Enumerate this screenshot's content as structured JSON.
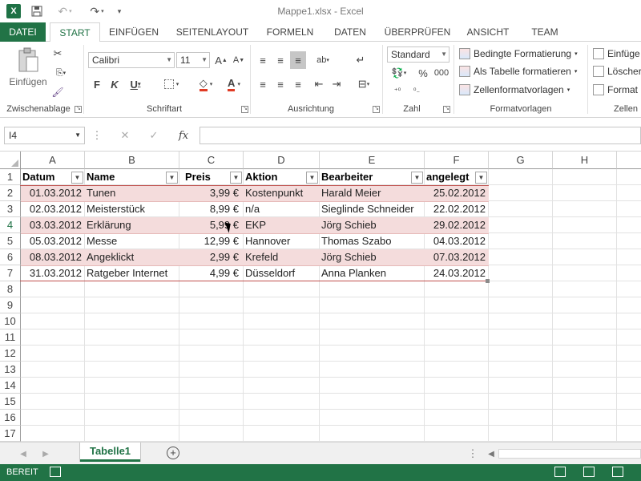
{
  "window": {
    "title": "Mappe1.xlsx - Excel",
    "app_logo": "X"
  },
  "quick_access": {
    "save_icon": "save-icon",
    "undo_icon": "undo-icon",
    "redo_icon": "redo-icon",
    "customize_icon": "customize-icon"
  },
  "tabs": {
    "file": "DATEI",
    "items": [
      "START",
      "EINFÜGEN",
      "SEITENLAYOUT",
      "FORMELN",
      "DATEN",
      "ÜBERPRÜFEN",
      "ANSICHT",
      "TEAM"
    ],
    "active": "START"
  },
  "ribbon": {
    "clipboard": {
      "paste_label": "Einfügen",
      "group_label": "Zwischenablage"
    },
    "font": {
      "name": "Calibri",
      "size": "11",
      "bold": "F",
      "italic": "K",
      "underline": "U",
      "group_label": "Schriftart"
    },
    "alignment": {
      "group_label": "Ausrichtung"
    },
    "number": {
      "format": "Standard",
      "percent": "%",
      "thousands": "000",
      "group_label": "Zahl"
    },
    "styles": {
      "conditional": "Bedingte Formatierung",
      "as_table": "Als Tabelle formatieren",
      "cell_styles": "Zellenformatvorlagen",
      "group_label": "Formatvorlagen"
    },
    "cells": {
      "insert": "Einfüge",
      "delete": "Löscher",
      "format": "Format",
      "group_label": "Zellen"
    }
  },
  "formula_bar": {
    "name_box": "I4",
    "fx": "fx",
    "value": ""
  },
  "sheet": {
    "columns": [
      "A",
      "B",
      "C",
      "D",
      "E",
      "F",
      "G",
      "H"
    ],
    "rows": [
      "1",
      "2",
      "3",
      "4",
      "5",
      "6",
      "7",
      "8",
      "9",
      "10",
      "11",
      "12",
      "13",
      "14",
      "15",
      "16",
      "17"
    ],
    "headers": [
      "Datum",
      "Name",
      "Preis",
      "Aktion",
      "Bearbeiter",
      "angelegt"
    ],
    "data": [
      [
        "01.03.2012",
        "Tunen",
        "3,99 €",
        "Kostenpunkt",
        "Harald Meier",
        "25.02.2012"
      ],
      [
        "02.03.2012",
        "Meisterstück",
        "8,99 €",
        "n/a",
        "Sieglinde Schneider",
        "22.02.2012"
      ],
      [
        "03.03.2012",
        "Erklärung",
        "5,99 €",
        "EKP",
        "Jörg Schieb",
        "29.02.2012"
      ],
      [
        "05.03.2012",
        "Messe",
        "12,99 €",
        "Hannover",
        "Thomas Szabo",
        "04.03.2012"
      ],
      [
        "08.03.2012",
        "Angeklickt",
        "2,99 €",
        "Krefeld",
        "Jörg Schieb",
        "07.03.2012"
      ],
      [
        "31.03.2012",
        "Ratgeber Internet",
        "4,99 €",
        "Düsseldorf",
        "Anna Planken",
        "24.03.2012"
      ]
    ],
    "band_color": "#f4dcdc",
    "table_border_color": "#c0504d"
  },
  "sheet_tabs": {
    "active": "Tabelle1"
  },
  "status_bar": {
    "ready": "BEREIT",
    "accent": "#217346"
  }
}
